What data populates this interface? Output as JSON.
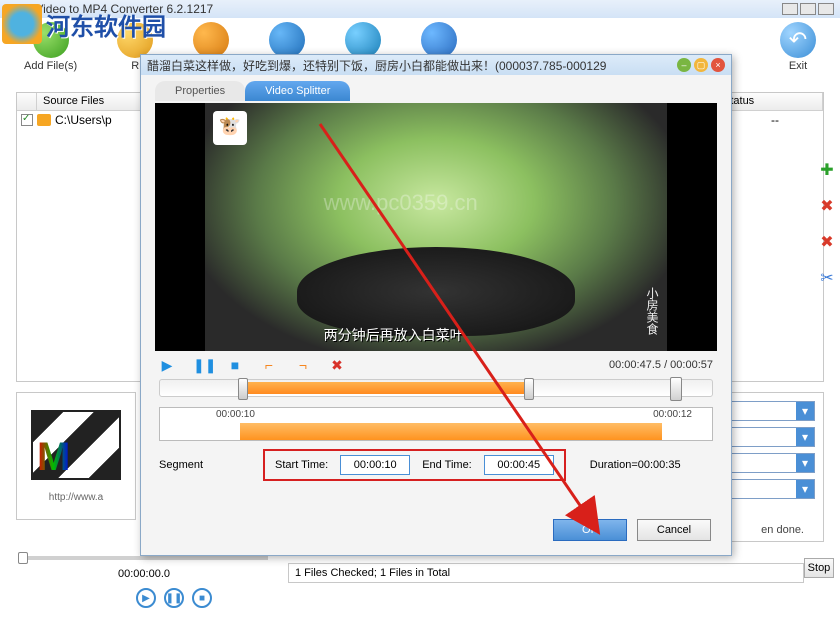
{
  "titlebar": {
    "title": "Allok Video to MP4 Converter 6.2.1217"
  },
  "watermark": {
    "text": "河东软件园",
    "url": "www.pc0359.cn"
  },
  "toolbar": {
    "add": "Add File(s)",
    "register": "R",
    "exit": "Exit"
  },
  "filelist": {
    "col_source": "Source Files",
    "col_status": "Status",
    "row1_path": "C:\\Users\\p",
    "row1_status": "--"
  },
  "player": {
    "time": "00:00:00.0"
  },
  "status": {
    "line": "1 Files Checked; 1 Files in Total",
    "done": "en done.",
    "stop": "Stop"
  },
  "preview": {
    "url": "http://www.a"
  },
  "dialog": {
    "title": "醋溜白菜这样做，好吃到爆，还特别下饭，厨房小白都能做出来！(000037.785-000129",
    "tab_properties": "Properties",
    "tab_splitter": "Video Splitter",
    "video_caption": "两分钟后再放入白菜叶",
    "video_side": "小房美食",
    "time_display": "00:00:47.5 / 00:00:57",
    "timeline_left": "00:00:10",
    "timeline_right": "00:00:12",
    "segment_label": "Segment",
    "start_label": "Start Time:",
    "end_label": "End Time:",
    "start_value": "00:00:10",
    "end_value": "00:00:45",
    "duration": "Duration=00:00:35",
    "ok": "OK",
    "cancel": "Cancel"
  }
}
